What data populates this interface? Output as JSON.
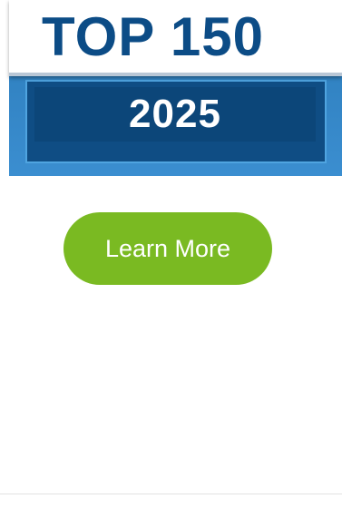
{
  "badge": {
    "title": "TOP 150",
    "year": "2025",
    "colors": {
      "title_text": "#0c4c86",
      "frame_blue": "#2a7ab8",
      "inner_navy": "#0c4679",
      "year_text": "#ffffff"
    }
  },
  "cta": {
    "label": "Learn More",
    "color": "#7aba22"
  }
}
